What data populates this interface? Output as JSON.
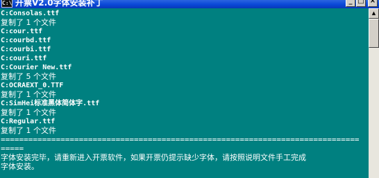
{
  "window": {
    "title": "开票V2.0字体安装补丁",
    "icon_label": "C:\\",
    "controls": {
      "minimize": "_",
      "maximize": "□",
      "close": "×"
    }
  },
  "console": {
    "lines": [
      {
        "text": "C:Consolas.ttf",
        "kind": "path"
      },
      {
        "text": "复制了 1 个文件",
        "kind": "text"
      },
      {
        "text": "C:cour.ttf",
        "kind": "path"
      },
      {
        "text": "C:courbd.ttf",
        "kind": "path"
      },
      {
        "text": "C:courbi.ttf",
        "kind": "path"
      },
      {
        "text": "C:couri.ttf",
        "kind": "path"
      },
      {
        "text": "C:Courier New.ttf",
        "kind": "path"
      },
      {
        "text": "复制了 5 个文件",
        "kind": "text"
      },
      {
        "text": "C:OCRAEXT_0.TTF",
        "kind": "path"
      },
      {
        "text": "复制了 1 个文件",
        "kind": "text"
      },
      {
        "text": "C:SimHei标准黑体简体字.ttf",
        "kind": "path"
      },
      {
        "text": "复制了 1 个文件",
        "kind": "text"
      },
      {
        "text": "C:Regular.ttf",
        "kind": "path"
      },
      {
        "text": "复制了 1 个文件",
        "kind": "text"
      },
      {
        "text": "==============================================================================",
        "kind": "rule"
      },
      {
        "text": "=====",
        "kind": "rule"
      },
      {
        "text": "字体安装完毕，请重新进入开票软件，如果开票仍提示缺少字体，请按照说明文件手工完成",
        "kind": "text"
      },
      {
        "text": "字体安装。",
        "kind": "text"
      }
    ]
  },
  "scrollbar": {
    "up_arrow": "▲"
  }
}
